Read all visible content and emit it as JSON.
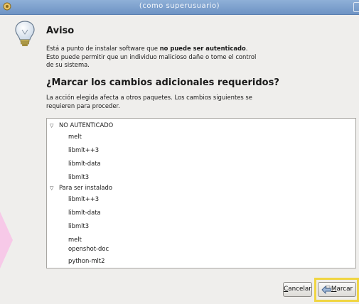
{
  "window": {
    "title": "(como superusuario)"
  },
  "dialog": {
    "heading": "Aviso",
    "message_pre": "Está a punto de instalar software que ",
    "message_bold": "no puede ser autenticado",
    "message_post": ". Esto puede permitir que un individuo malicioso dañe o tome el control de su sistema.",
    "question": "¿Marcar los cambios adicionales requeridos?",
    "note": "La acción elegida afecta a otros paquetes. Los cambios siguientes se requieren para proceder."
  },
  "tree": {
    "groups": [
      {
        "label": "NO AUTENTICADO",
        "items": [
          "melt",
          "libmlt++3",
          "libmlt-data",
          "libmlt3"
        ]
      },
      {
        "label": "Para ser instalado",
        "items": [
          "libmlt++3",
          "libmlt-data",
          "libmlt3",
          "melt",
          "openshot-doc",
          "python-mlt2"
        ]
      }
    ]
  },
  "buttons": {
    "cancel_label": "Cancelar",
    "cancel_mnemonic": "C",
    "cancel_rest": "ancelar",
    "mark_label": "Marcar",
    "mark_mnemonic": "M",
    "mark_rest": "arcar"
  },
  "colors": {
    "highlight": "#f0d542",
    "titlebar": "#7a9dcc"
  }
}
